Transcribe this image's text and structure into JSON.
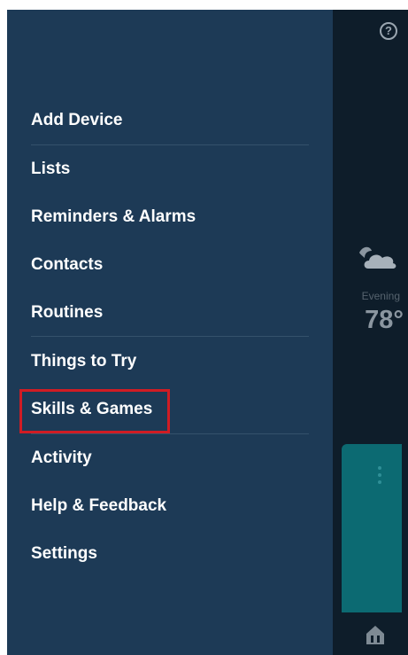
{
  "drawer": {
    "items": [
      {
        "label": "Add Device"
      },
      {
        "label": "Lists"
      },
      {
        "label": "Reminders & Alarms"
      },
      {
        "label": "Contacts"
      },
      {
        "label": "Routines"
      },
      {
        "label": "Things to Try"
      },
      {
        "label": "Skills & Games",
        "highlighted": true
      },
      {
        "label": "Activity"
      },
      {
        "label": "Help & Feedback"
      },
      {
        "label": "Settings"
      }
    ]
  },
  "background": {
    "help_icon": "?",
    "weather": {
      "icon": "partly-cloudy-night-icon",
      "period": "Evening",
      "temperature": "78°"
    }
  },
  "colors": {
    "drawer_bg": "#1d3a56",
    "background_bg": "#0e1d2a",
    "card_teal": "#0c6a72",
    "highlight_red": "#d01c24"
  }
}
